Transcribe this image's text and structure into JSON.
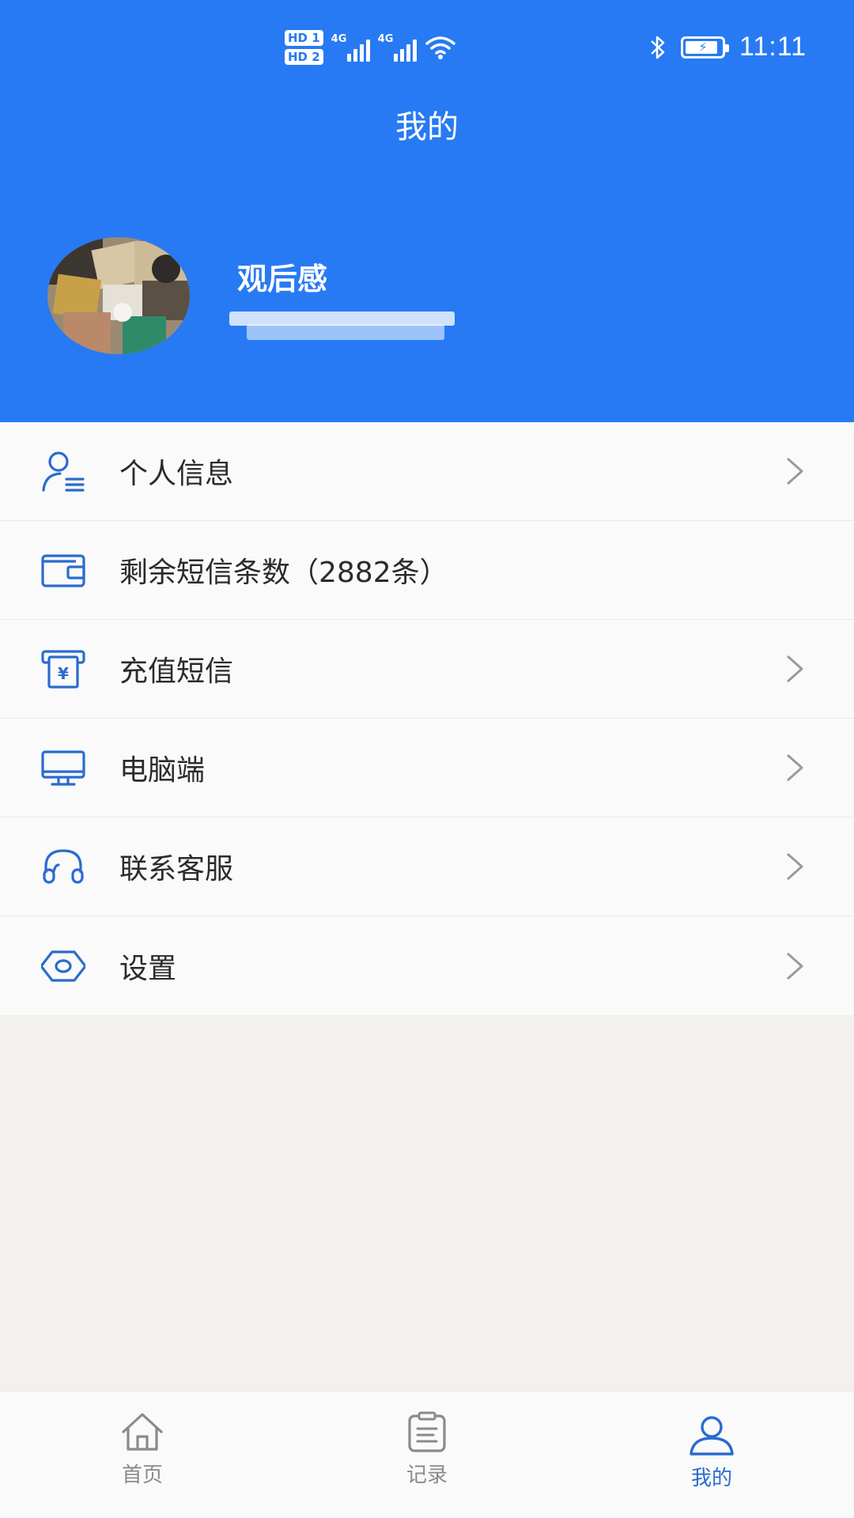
{
  "status_bar": {
    "sim1_label": "HD 1",
    "sim2_label": "HD 2",
    "network1": "4G",
    "network2": "4G",
    "time": "11:11",
    "icons": [
      "bluetooth-icon",
      "battery-charging-icon",
      "wifi-icon",
      "signal-icon"
    ]
  },
  "header": {
    "title": "我的"
  },
  "profile": {
    "name": "观后感"
  },
  "menu": {
    "items": [
      {
        "label": "个人信息",
        "icon": "user-info-icon",
        "has_chevron": true
      },
      {
        "label": "剩余短信条数（2882条）",
        "icon": "wallet-icon",
        "has_chevron": false
      },
      {
        "label": "充值短信",
        "icon": "recharge-icon",
        "has_chevron": true
      },
      {
        "label": "电脑端",
        "icon": "monitor-icon",
        "has_chevron": true
      },
      {
        "label": "联系客服",
        "icon": "headset-icon",
        "has_chevron": true
      },
      {
        "label": "设置",
        "icon": "settings-icon",
        "has_chevron": true
      }
    ]
  },
  "tabbar": {
    "tabs": [
      {
        "label": "首页",
        "icon": "home-icon",
        "active": false
      },
      {
        "label": "记录",
        "icon": "clipboard-icon",
        "active": false
      },
      {
        "label": "我的",
        "icon": "user-icon",
        "active": true
      }
    ]
  },
  "colors": {
    "primary": "#277af3",
    "icon_blue": "#2a6bcf",
    "background": "#f2f1ee",
    "menu_bg": "#fafafa",
    "text": "#2b2b2b",
    "tab_inactive": "#8a8a8a"
  }
}
